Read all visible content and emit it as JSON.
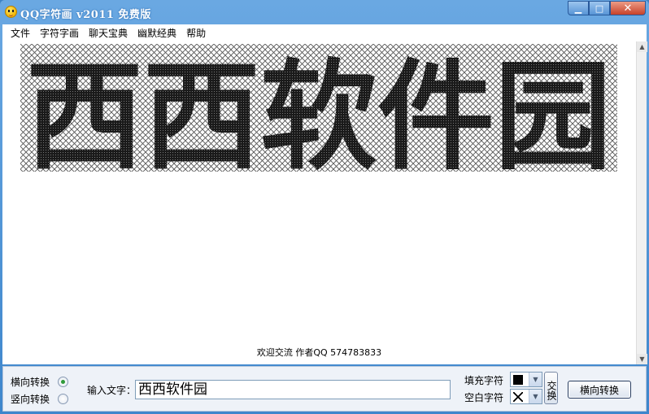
{
  "window": {
    "title": "QQ字符画  v2011  免费版",
    "app_icon": "smiley-icon",
    "controls": {
      "minimize": "▁",
      "maximize": "□",
      "close": "✕"
    }
  },
  "menu": {
    "items": [
      {
        "label": "文件"
      },
      {
        "label": "字符字画"
      },
      {
        "label": "聊天宝典"
      },
      {
        "label": "幽默经典"
      },
      {
        "label": "帮助"
      }
    ]
  },
  "canvas": {
    "art_text": "西西软件园",
    "fill_color": "#1a1a1a",
    "blank_color": "#555555",
    "credit": "欢迎交流  作者QQ 574783833"
  },
  "bottom": {
    "direction_options": [
      {
        "label": "横向转换",
        "selected": true
      },
      {
        "label": "竖向转换",
        "selected": false
      }
    ],
    "input_label": "输入文字：",
    "input_value": "西西软件园",
    "fill_char_label": "填充字符",
    "blank_char_label": "空白字符",
    "fill_char_icon": "dense-grid-swatch-icon",
    "blank_char_icon": "cross-swatch-icon",
    "swap_label": "交换",
    "convert_label": "横向转换"
  }
}
